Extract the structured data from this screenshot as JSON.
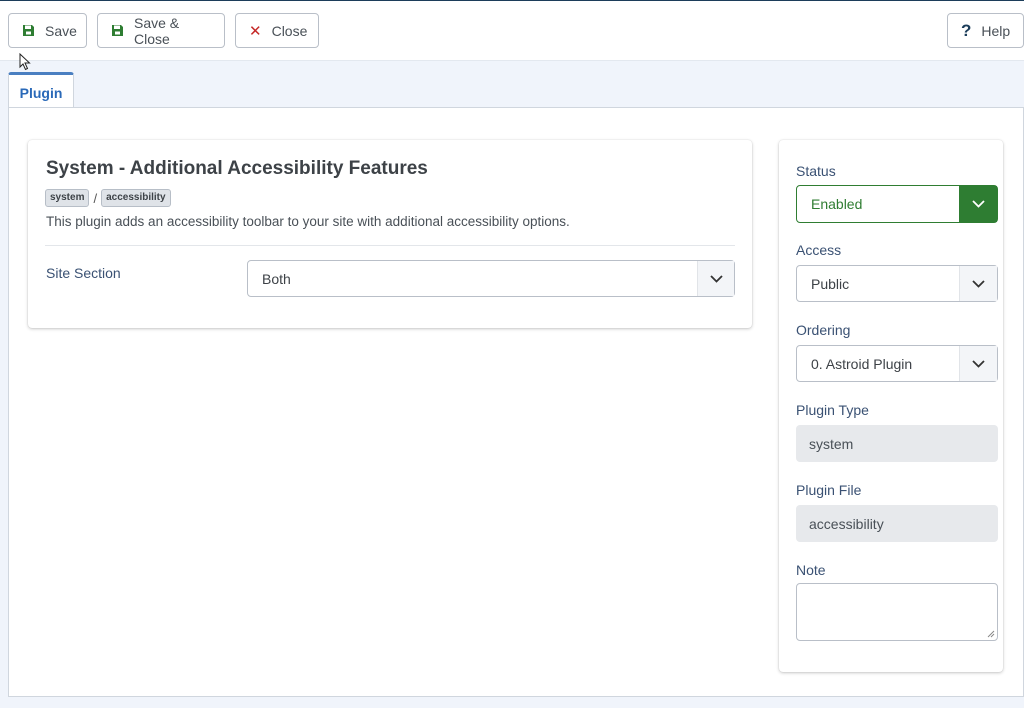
{
  "toolbar": {
    "save_label": "Save",
    "save_close_label": "Save & Close",
    "close_label": "Close",
    "help_label": "Help",
    "help_glyph": "?",
    "close_glyph": "✕"
  },
  "tabs": [
    {
      "label": "Plugin",
      "active": true
    }
  ],
  "plugin": {
    "title": "System - Additional Accessibility Features",
    "badges": [
      "system",
      "accessibility"
    ],
    "separator": "/",
    "description": "This plugin adds an accessibility toolbar to your site with additional accessibility options.",
    "site_section": {
      "label": "Site Section",
      "value": "Both"
    }
  },
  "sidebar": {
    "status": {
      "label": "Status",
      "value": "Enabled"
    },
    "access": {
      "label": "Access",
      "value": "Public"
    },
    "ordering": {
      "label": "Ordering",
      "value": "0. Astroid Plugin"
    },
    "plugin_type": {
      "label": "Plugin Type",
      "value": "system"
    },
    "plugin_file": {
      "label": "Plugin File",
      "value": "accessibility"
    },
    "note": {
      "label": "Note",
      "value": ""
    }
  },
  "icons": {
    "save": "floppy-disk-icon",
    "close": "x-icon",
    "help": "question-icon",
    "dropdown": "chevron-down-icon"
  },
  "colors": {
    "accent": "#2a69b8",
    "enabled": "#2e7d32",
    "danger": "#c52827",
    "label": "#3a5173"
  }
}
